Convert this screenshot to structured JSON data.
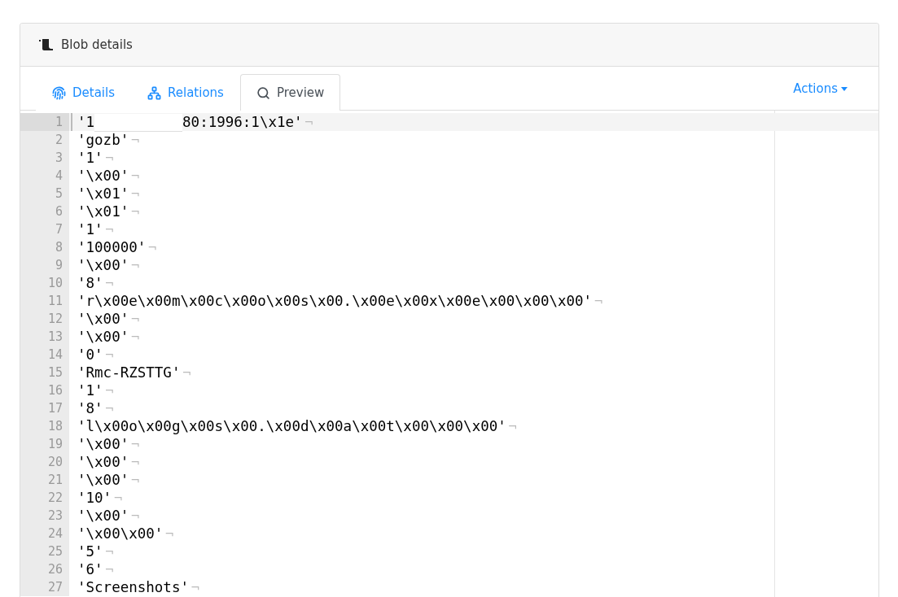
{
  "card": {
    "title": "Blob details"
  },
  "tabs": [
    {
      "label": "Details",
      "selected": false
    },
    {
      "label": "Relations",
      "selected": false
    },
    {
      "label": "Preview",
      "selected": true
    }
  ],
  "actions": {
    "label": "Actions"
  },
  "editor": {
    "lines": [
      {
        "number": "1",
        "parts": [
          "'1",
          "80:1996:1\\x1e'"
        ],
        "eol": "¬",
        "selected": true
      },
      {
        "number": "2",
        "parts": [
          "'gozb'"
        ],
        "eol": "¬",
        "selected": false
      },
      {
        "number": "3",
        "parts": [
          "'1'"
        ],
        "eol": "¬",
        "selected": false
      },
      {
        "number": "4",
        "parts": [
          "'\\x00'"
        ],
        "eol": "¬",
        "selected": false
      },
      {
        "number": "5",
        "parts": [
          "'\\x01'"
        ],
        "eol": "¬",
        "selected": false
      },
      {
        "number": "6",
        "parts": [
          "'\\x01'"
        ],
        "eol": "¬",
        "selected": false
      },
      {
        "number": "7",
        "parts": [
          "'1'"
        ],
        "eol": "¬",
        "selected": false
      },
      {
        "number": "8",
        "parts": [
          "'100000'"
        ],
        "eol": "¬",
        "selected": false
      },
      {
        "number": "9",
        "parts": [
          "'\\x00'"
        ],
        "eol": "¬",
        "selected": false
      },
      {
        "number": "10",
        "parts": [
          "'8'"
        ],
        "eol": "¬",
        "selected": false
      },
      {
        "number": "11",
        "parts": [
          "'r\\x00e\\x00m\\x00c\\x00o\\x00s\\x00.\\x00e\\x00x\\x00e\\x00\\x00\\x00'"
        ],
        "eol": "¬",
        "selected": false
      },
      {
        "number": "12",
        "parts": [
          "'\\x00'"
        ],
        "eol": "¬",
        "selected": false
      },
      {
        "number": "13",
        "parts": [
          "'\\x00'"
        ],
        "eol": "¬",
        "selected": false
      },
      {
        "number": "14",
        "parts": [
          "'0'"
        ],
        "eol": "¬",
        "selected": false
      },
      {
        "number": "15",
        "parts": [
          "'Rmc-RZSTTG'"
        ],
        "eol": "¬",
        "selected": false
      },
      {
        "number": "16",
        "parts": [
          "'1'"
        ],
        "eol": "¬",
        "selected": false
      },
      {
        "number": "17",
        "parts": [
          "'8'"
        ],
        "eol": "¬",
        "selected": false
      },
      {
        "number": "18",
        "parts": [
          "'l\\x00o\\x00g\\x00s\\x00.\\x00d\\x00a\\x00t\\x00\\x00\\x00'"
        ],
        "eol": "¬",
        "selected": false
      },
      {
        "number": "19",
        "parts": [
          "'\\x00'"
        ],
        "eol": "¬",
        "selected": false
      },
      {
        "number": "20",
        "parts": [
          "'\\x00'"
        ],
        "eol": "¬",
        "selected": false
      },
      {
        "number": "21",
        "parts": [
          "'\\x00'"
        ],
        "eol": "¬",
        "selected": false
      },
      {
        "number": "22",
        "parts": [
          "'10'"
        ],
        "eol": "¬",
        "selected": false
      },
      {
        "number": "23",
        "parts": [
          "'\\x00'"
        ],
        "eol": "¬",
        "selected": false
      },
      {
        "number": "24",
        "parts": [
          "'\\x00\\x00'"
        ],
        "eol": "¬",
        "selected": false
      },
      {
        "number": "25",
        "parts": [
          "'5'"
        ],
        "eol": "¬",
        "selected": false
      },
      {
        "number": "26",
        "parts": [
          "'6'"
        ],
        "eol": "¬",
        "selected": false
      },
      {
        "number": "27",
        "parts": [
          "'Screenshots'"
        ],
        "eol": "¬",
        "selected": false
      }
    ]
  }
}
